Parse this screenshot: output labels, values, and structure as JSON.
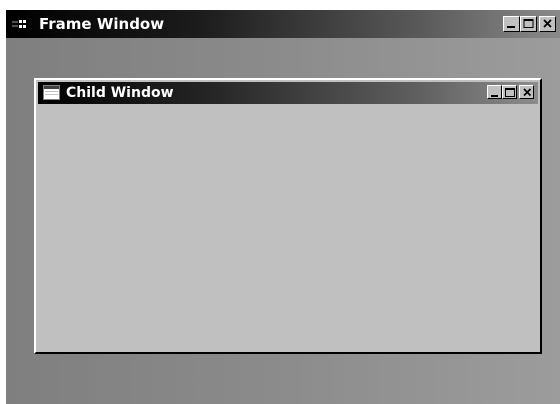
{
  "frame_window": {
    "title": "Frame Window",
    "icon": "application-icon",
    "buttons": [
      "minimize-icon",
      "maximize-icon",
      "close-icon"
    ]
  },
  "child_window": {
    "title": "Child Window",
    "icon": "document-icon",
    "buttons": [
      "minimize-icon",
      "maximize-icon",
      "close-icon"
    ]
  },
  "colors": {
    "title_active_start": "#000000",
    "title_active_end": "#8a8a8a",
    "face": "#c0c0c0",
    "mdi_client": "#8a8a8a"
  }
}
